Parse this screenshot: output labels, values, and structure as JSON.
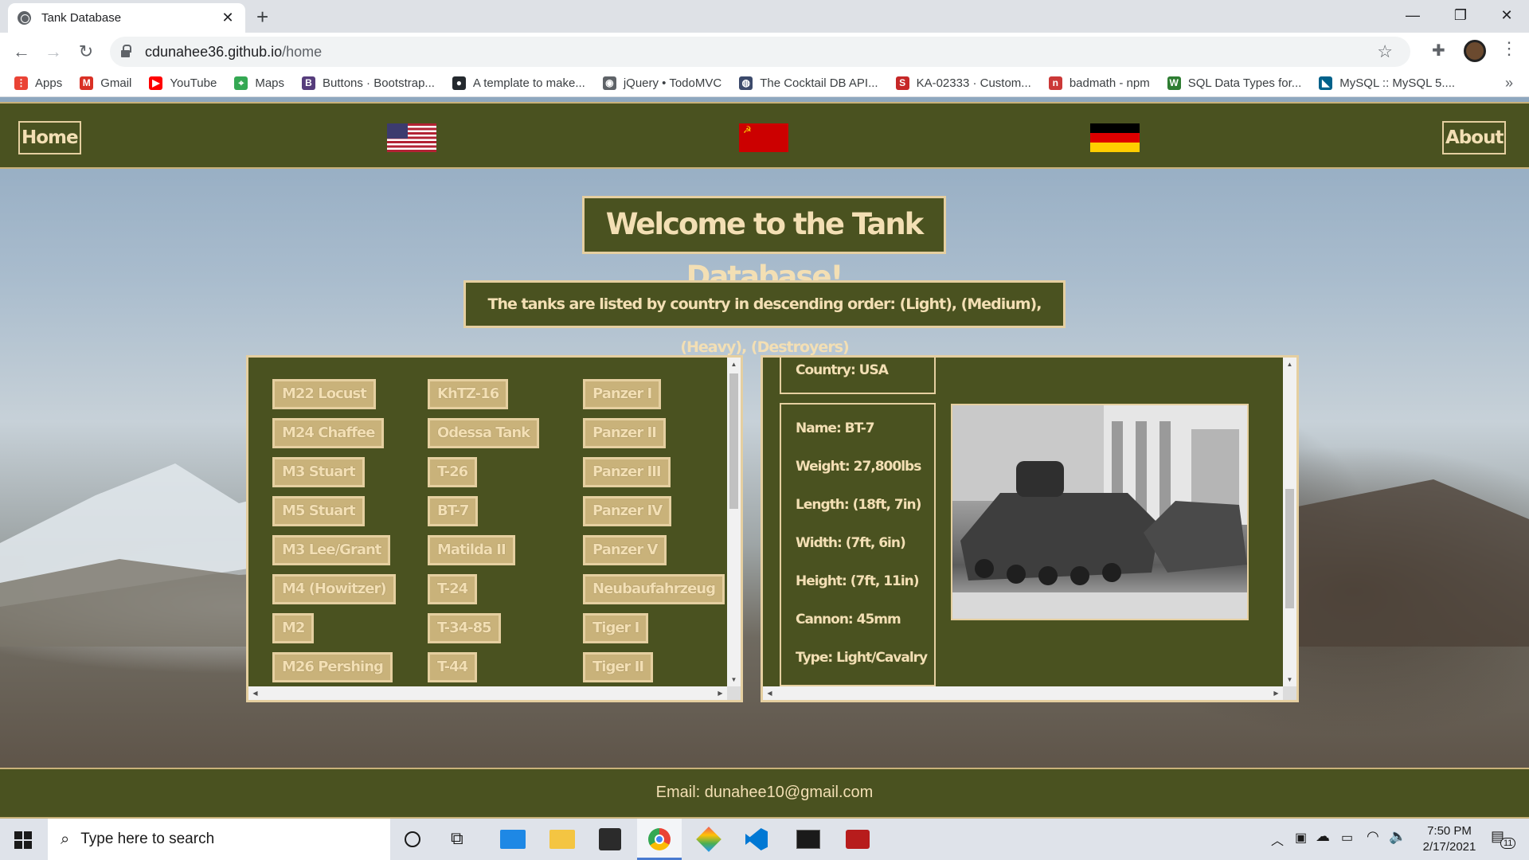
{
  "browser": {
    "tab_title": "Tank Database",
    "tab_close": "✕",
    "new_tab": "+",
    "url_host": "cdunahee36.github.io",
    "url_path": "/home",
    "bookmarks": [
      {
        "label": "Apps",
        "color": "#ea4335",
        "glyph": "⋮"
      },
      {
        "label": "Gmail",
        "color": "#d93025",
        "glyph": "M"
      },
      {
        "label": "YouTube",
        "color": "#ff0000",
        "glyph": "▶"
      },
      {
        "label": "Maps",
        "color": "#34a853",
        "glyph": "⌖"
      },
      {
        "label": "Buttons · Bootstrap...",
        "color": "#563d7c",
        "glyph": "B"
      },
      {
        "label": "A template to make...",
        "color": "#24292e",
        "glyph": "●"
      },
      {
        "label": "jQuery • TodoMVC",
        "color": "#5f6368",
        "glyph": "◉"
      },
      {
        "label": "The Cocktail DB API...",
        "color": "#3c4a6b",
        "glyph": "◍"
      },
      {
        "label": "KA-02333 · Custom...",
        "color": "#c62828",
        "glyph": "S"
      },
      {
        "label": "badmath - npm",
        "color": "#cb3837",
        "glyph": "n"
      },
      {
        "label": "SQL Data Types for...",
        "color": "#2e7d32",
        "glyph": "W"
      },
      {
        "label": "MySQL :: MySQL 5....",
        "color": "#00618a",
        "glyph": "◣"
      }
    ]
  },
  "nav": {
    "home": "Home",
    "about": "About"
  },
  "hero": {
    "title": "Welcome to the Tank Database!",
    "subtitle": "The tanks are listed by country in descending order: (Light), (Medium), (Heavy), (Destroyers)"
  },
  "tanks": {
    "usa": [
      "M22 Locust",
      "M24 Chaffee",
      "M3 Stuart",
      "M5 Stuart",
      "M3 Lee/Grant",
      "M4 (Howitzer)",
      "M2",
      "M26 Pershing"
    ],
    "ussr": [
      "KhTZ-16",
      "Odessa Tank",
      "T-26",
      "BT-7",
      "Matilda II",
      "T-24",
      "T-34-85",
      "T-44"
    ],
    "germany": [
      "Panzer I",
      "Panzer II",
      "Panzer III",
      "Panzer IV",
      "Panzer V",
      "Neubaufahrzeug",
      "Tiger I",
      "Tiger II"
    ]
  },
  "detail": {
    "prev_country": "Country: USA",
    "name": "Name: BT-7",
    "weight": "Weight: 27,800lbs",
    "length": "Length: (18ft, 7in)",
    "width": "Width: (7ft, 6in)",
    "height": "Height: (7ft, 11in)",
    "cannon": "Cannon: 45mm",
    "type": "Type: Light/Cavalry"
  },
  "footer": {
    "email": "Email: dunahee10@gmail.com"
  },
  "taskbar": {
    "search_placeholder": "Type here to search",
    "time": "7:50 PM",
    "date": "2/17/2021",
    "notification_count": "11"
  }
}
